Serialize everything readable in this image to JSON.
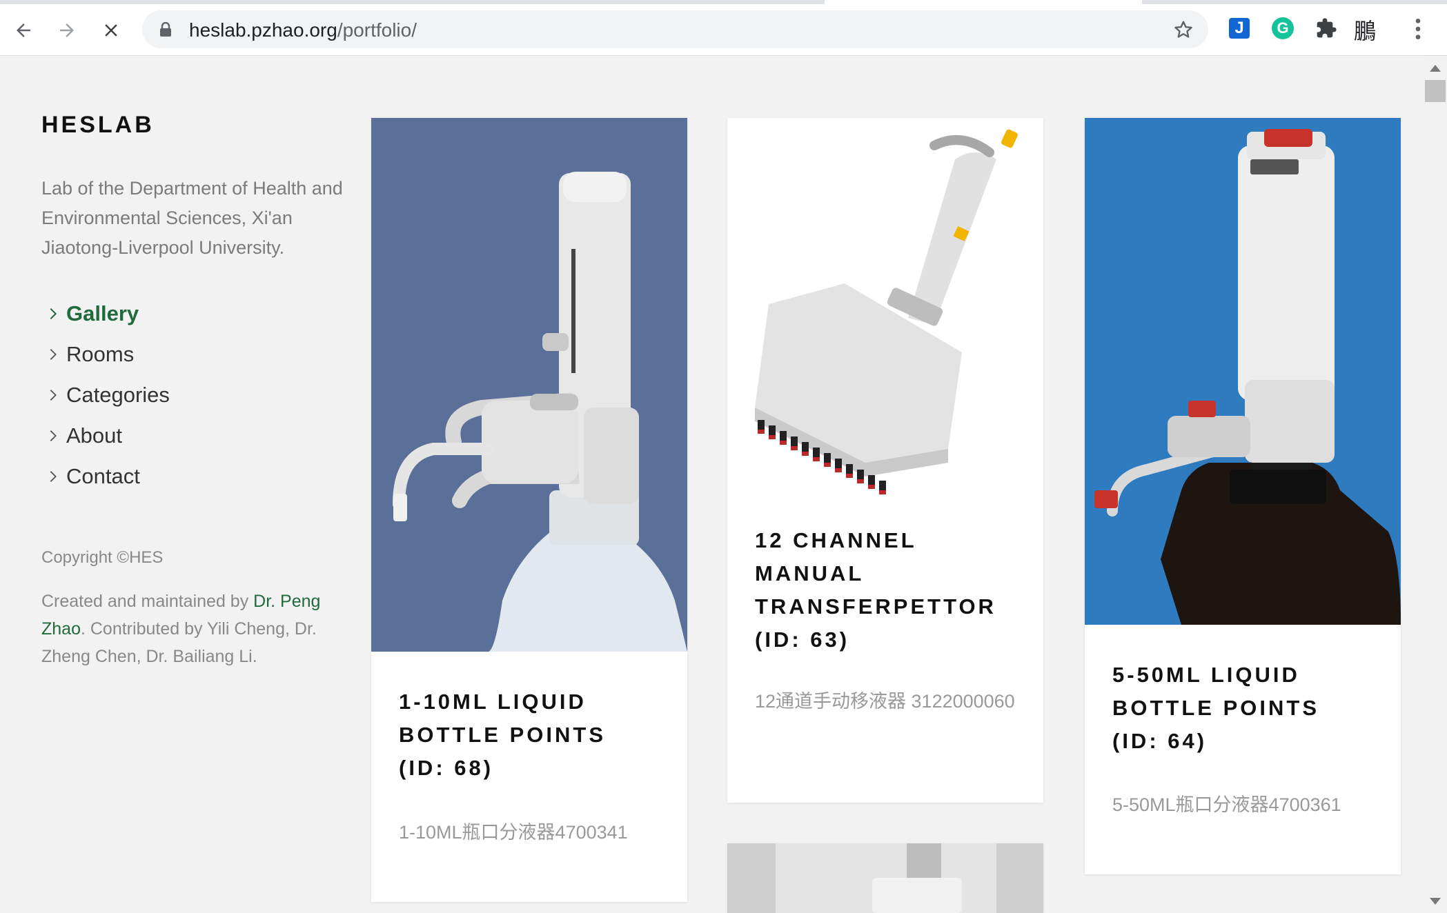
{
  "browser": {
    "url_host": "heslab.pzhao.org",
    "url_path": "/portfolio/",
    "profile_glyph": "鵬",
    "extensions": {
      "j_label": "J",
      "g_label": "G"
    }
  },
  "sidebar": {
    "brand": "HESLAB",
    "description": "Lab of the Department of Health and Environmental Sciences, Xi'an Jiaotong-Liverpool University.",
    "nav": [
      {
        "label": "Gallery",
        "active": true
      },
      {
        "label": "Rooms"
      },
      {
        "label": "Categories"
      },
      {
        "label": "About"
      },
      {
        "label": "Contact"
      }
    ],
    "copyright": "Copyright ©HES",
    "credits_prefix": "Created and maintained by ",
    "credits_link": "Dr. Peng Zhao",
    "credits_suffix": ". Contributed by Yili Cheng, Dr. Zheng Chen, Dr. Bailiang Li."
  },
  "cards": [
    {
      "title": "1-10ML LIQUID BOTTLE POINTS (ID: 68)",
      "subtitle": "1-10ML瓶口分液器4700341",
      "image": "bottle-top-dispenser-photo"
    },
    {
      "title": "12 CHANNEL MANUAL TRANSFERPETTOR (ID: 63)",
      "subtitle": "12通道手动移液器 3122000060",
      "image": "multichannel-pipette-photo"
    },
    {
      "title": "5-50ML LIQUID BOTTLE POINTS (ID: 64)",
      "subtitle": "5-50ML瓶口分液器4700361",
      "image": "dispenser-on-brown-bottle-photo"
    },
    {
      "image": "pipette-partial-photo"
    }
  ],
  "colors": {
    "accent_green": "#206a3b",
    "card_bg_blue_grey": "#5b7099",
    "card_bg_blue": "#2f7bc0"
  }
}
